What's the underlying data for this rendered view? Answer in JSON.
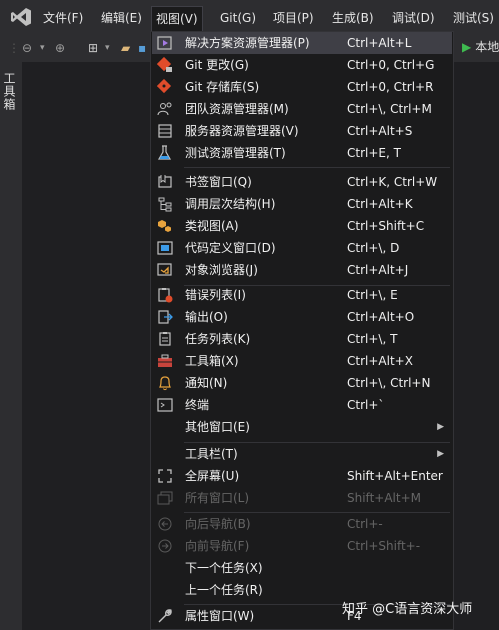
{
  "menubar": {
    "items": [
      "文件(F)",
      "编辑(E)",
      "视图(V)",
      "Git(G)",
      "项目(P)",
      "生成(B)",
      "调试(D)",
      "测试(S)"
    ]
  },
  "toolbar": {
    "start_label": "本地"
  },
  "sidebar": {
    "toolbox_tab": "工具箱"
  },
  "view_menu": {
    "items": [
      {
        "label": "解决方案资源管理器(P)",
        "shortcut": "Ctrl+Alt+L",
        "icon": "solution-explorer-icon"
      },
      {
        "label": "Git 更改(G)",
        "shortcut": "Ctrl+0, Ctrl+G",
        "icon": "git-changes-icon"
      },
      {
        "label": "Git 存储库(S)",
        "shortcut": "Ctrl+0, Ctrl+R",
        "icon": "git-repository-icon"
      },
      {
        "label": "团队资源管理器(M)",
        "shortcut": "Ctrl+\\, Ctrl+M",
        "icon": "team-explorer-icon"
      },
      {
        "label": "服务器资源管理器(V)",
        "shortcut": "Ctrl+Alt+S",
        "icon": "server-explorer-icon"
      },
      {
        "label": "测试资源管理器(T)",
        "shortcut": "Ctrl+E, T",
        "icon": "test-explorer-icon"
      },
      {
        "label": "书签窗口(Q)",
        "shortcut": "Ctrl+K, Ctrl+W",
        "icon": "bookmark-icon"
      },
      {
        "label": "调用层次结构(H)",
        "shortcut": "Ctrl+Alt+K",
        "icon": "call-hierarchy-icon"
      },
      {
        "label": "类视图(A)",
        "shortcut": "Ctrl+Shift+C",
        "icon": "class-view-icon"
      },
      {
        "label": "代码定义窗口(D)",
        "shortcut": "Ctrl+\\, D",
        "icon": "code-definition-icon"
      },
      {
        "label": "对象浏览器(J)",
        "shortcut": "Ctrl+Alt+J",
        "icon": "object-browser-icon"
      },
      {
        "label": "错误列表(I)",
        "shortcut": "Ctrl+\\, E",
        "icon": "error-list-icon"
      },
      {
        "label": "输出(O)",
        "shortcut": "Ctrl+Alt+O",
        "icon": "output-icon"
      },
      {
        "label": "任务列表(K)",
        "shortcut": "Ctrl+\\, T",
        "icon": "task-list-icon"
      },
      {
        "label": "工具箱(X)",
        "shortcut": "Ctrl+Alt+X",
        "icon": "toolbox-icon"
      },
      {
        "label": "通知(N)",
        "shortcut": "Ctrl+\\, Ctrl+N",
        "icon": "notification-bell-icon"
      },
      {
        "label": "终端",
        "shortcut": "Ctrl+`",
        "icon": "terminal-icon"
      },
      {
        "label": "其他窗口(E)",
        "shortcut": "",
        "icon": ""
      },
      {
        "label": "工具栏(T)",
        "shortcut": "",
        "icon": ""
      },
      {
        "label": "全屏幕(U)",
        "shortcut": "Shift+Alt+Enter",
        "icon": "fullscreen-icon"
      },
      {
        "label": "所有窗口(L)",
        "shortcut": "Shift+Alt+M",
        "icon": "all-windows-icon"
      },
      {
        "label": "向后导航(B)",
        "shortcut": "Ctrl+-",
        "icon": "navigate-back-icon"
      },
      {
        "label": "向前导航(F)",
        "shortcut": "Ctrl+Shift+-",
        "icon": "navigate-forward-icon"
      },
      {
        "label": "下一个任务(X)",
        "shortcut": "",
        "icon": ""
      },
      {
        "label": "上一个任务(R)",
        "shortcut": "",
        "icon": ""
      },
      {
        "label": "属性窗口(W)",
        "shortcut": "F4",
        "icon": "wrench-icon"
      }
    ]
  },
  "watermark": "知乎 @C语言资深大师",
  "colors": {
    "menu_bg": "#1b1b1c",
    "highlight": "#3f3f46",
    "accent": "#68217a",
    "text": "#f1f1f1",
    "disabled": "#656565"
  }
}
